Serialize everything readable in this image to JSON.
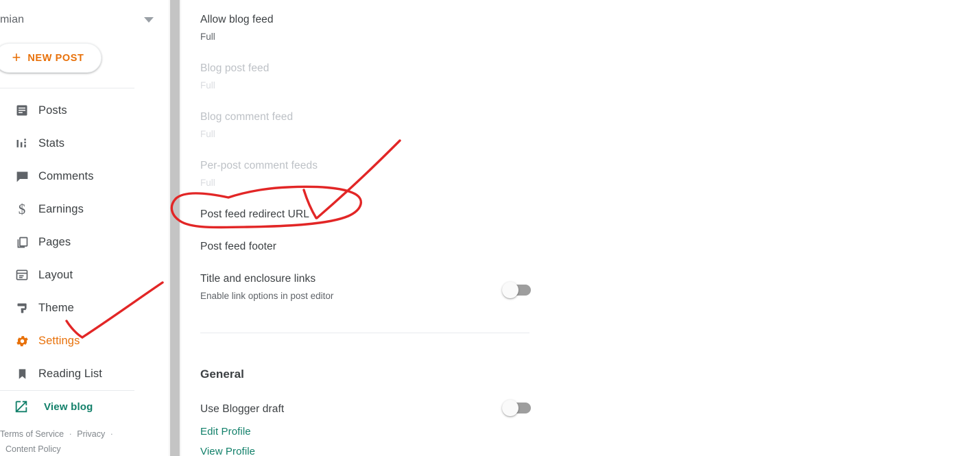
{
  "sidebar": {
    "blog_selector": {
      "name": "mian",
      "caret_icon": "chevron-down-icon"
    },
    "new_post": {
      "label": "NEW POST",
      "plus_icon": "plus-icon"
    },
    "items": [
      {
        "label": "Posts",
        "icon": "posts-icon",
        "active": false
      },
      {
        "label": "Stats",
        "icon": "stats-icon",
        "active": false
      },
      {
        "label": "Comments",
        "icon": "comments-icon",
        "active": false
      },
      {
        "label": "Earnings",
        "icon": "dollar-icon",
        "active": false
      },
      {
        "label": "Pages",
        "icon": "pages-icon",
        "active": false
      },
      {
        "label": "Layout",
        "icon": "layout-icon",
        "active": false
      },
      {
        "label": "Theme",
        "icon": "theme-icon",
        "active": false
      },
      {
        "label": "Settings",
        "icon": "gear-icon",
        "active": true
      },
      {
        "label": "Reading List",
        "icon": "bookmark-icon",
        "active": false
      }
    ],
    "view_blog": {
      "label": "View blog",
      "icon": "external-link-icon"
    },
    "legal": {
      "terms": "Terms of Service",
      "separator": "·",
      "privacy": "Privacy",
      "content_policy": "Content Policy"
    }
  },
  "main": {
    "settings": [
      {
        "title": "Allow blog feed",
        "value": "Full",
        "dimmed": false
      },
      {
        "title": "Blog post feed",
        "value": "Full",
        "dimmed": true
      },
      {
        "title": "Blog comment feed",
        "value": "Full",
        "dimmed": true
      },
      {
        "title": "Per-post comment feeds",
        "value": "Full",
        "dimmed": true
      },
      {
        "title": "Post feed redirect URL",
        "value": "",
        "dimmed": false
      },
      {
        "title": "Post feed footer",
        "value": "",
        "dimmed": false
      }
    ],
    "title_enclosure": {
      "title": "Title and enclosure links",
      "subtitle": "Enable link options in post editor",
      "toggle_state": "off"
    },
    "general": {
      "heading": "General",
      "use_blogger_draft": {
        "label": "Use Blogger draft",
        "toggle_state": "off"
      },
      "edit_profile": "Edit Profile",
      "view_profile": "View Profile"
    }
  },
  "annotations": {
    "color": "#e22626",
    "ellipse_target": "Post feed redirect URL",
    "arrow_target": "Settings"
  },
  "colors": {
    "accent_orange": "#e8710a",
    "link_teal": "#12806a",
    "text_primary": "#3c4043",
    "text_secondary": "#5f6368",
    "text_dim": "#bdc1c6",
    "annotation_red": "#e22626"
  }
}
